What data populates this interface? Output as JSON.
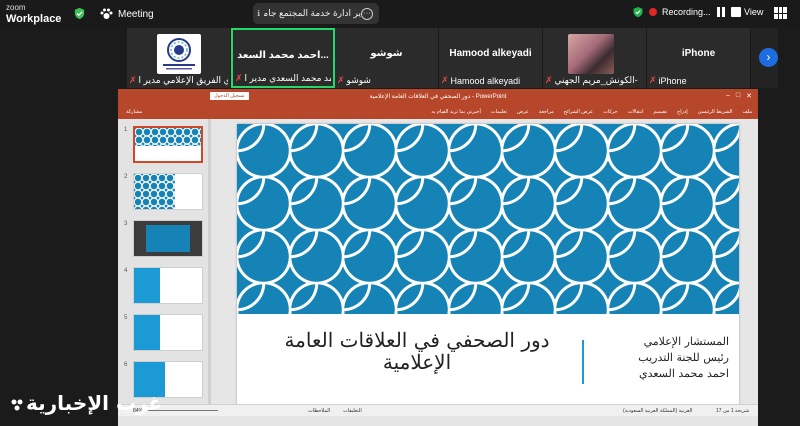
{
  "app": {
    "logo_line1": "zoom",
    "logo_line2": "Workplace"
  },
  "topbar": {
    "meeting_label": "Meeting",
    "title": "ير ادارة خدمة المجتمع جامعة شقراء",
    "more_label": "···",
    "recording_label": "Recording...",
    "view_label": "View"
  },
  "participants": [
    {
      "display": "",
      "caption": "نادي الفريق الإعلامي مدير ا..."
    },
    {
      "display": "احمد محمد السعد...",
      "caption": "احمد محمد السعدي مدير ا..."
    },
    {
      "display": "شوشو",
      "caption": "شوشو"
    },
    {
      "display": "Hamood alkeyadi",
      "caption": "Hamood alkeyadi"
    },
    {
      "display": "",
      "caption": "الكونش_مريم الجهني-"
    },
    {
      "display": "iPhone",
      "caption": "iPhone"
    }
  ],
  "next_label": "›",
  "powerpoint": {
    "title": "دور الصحفي في العلاقات العامة الإعلامية - PowerPoint",
    "login_label": "تسجيل الدخول",
    "ribbon": [
      "ملف",
      "الشريط الرئيسي",
      "إدراج",
      "تصميم",
      "انتقالات",
      "حركات",
      "عرض الشرائح",
      "مراجعة",
      "عرض",
      "تعليمات",
      "أخبرني بما تريد القيام به"
    ],
    "share_label": "مشاركة",
    "slide_numbers": [
      "1",
      "2",
      "3",
      "4",
      "5",
      "6"
    ],
    "slide": {
      "title": "دور الصحفي في العلاقات العامة الإعلامية",
      "subtitle_lines": [
        "المستشار الإعلامي",
        "رئيس للجنة التدريب",
        "احمد محمد السعدي"
      ]
    },
    "status": {
      "zoom": "84%",
      "notes": "الملاحظات",
      "comments": "التعليقات",
      "language": "العربية (المملكة العربية السعودية)",
      "slide_counter": "شريحة 1 من 17"
    }
  },
  "watermark": "غرب الإخبارية",
  "colors": {
    "accent": "#1583b5",
    "ppt": "#b7472a",
    "rec": "#e02828",
    "active": "#23d96b"
  }
}
